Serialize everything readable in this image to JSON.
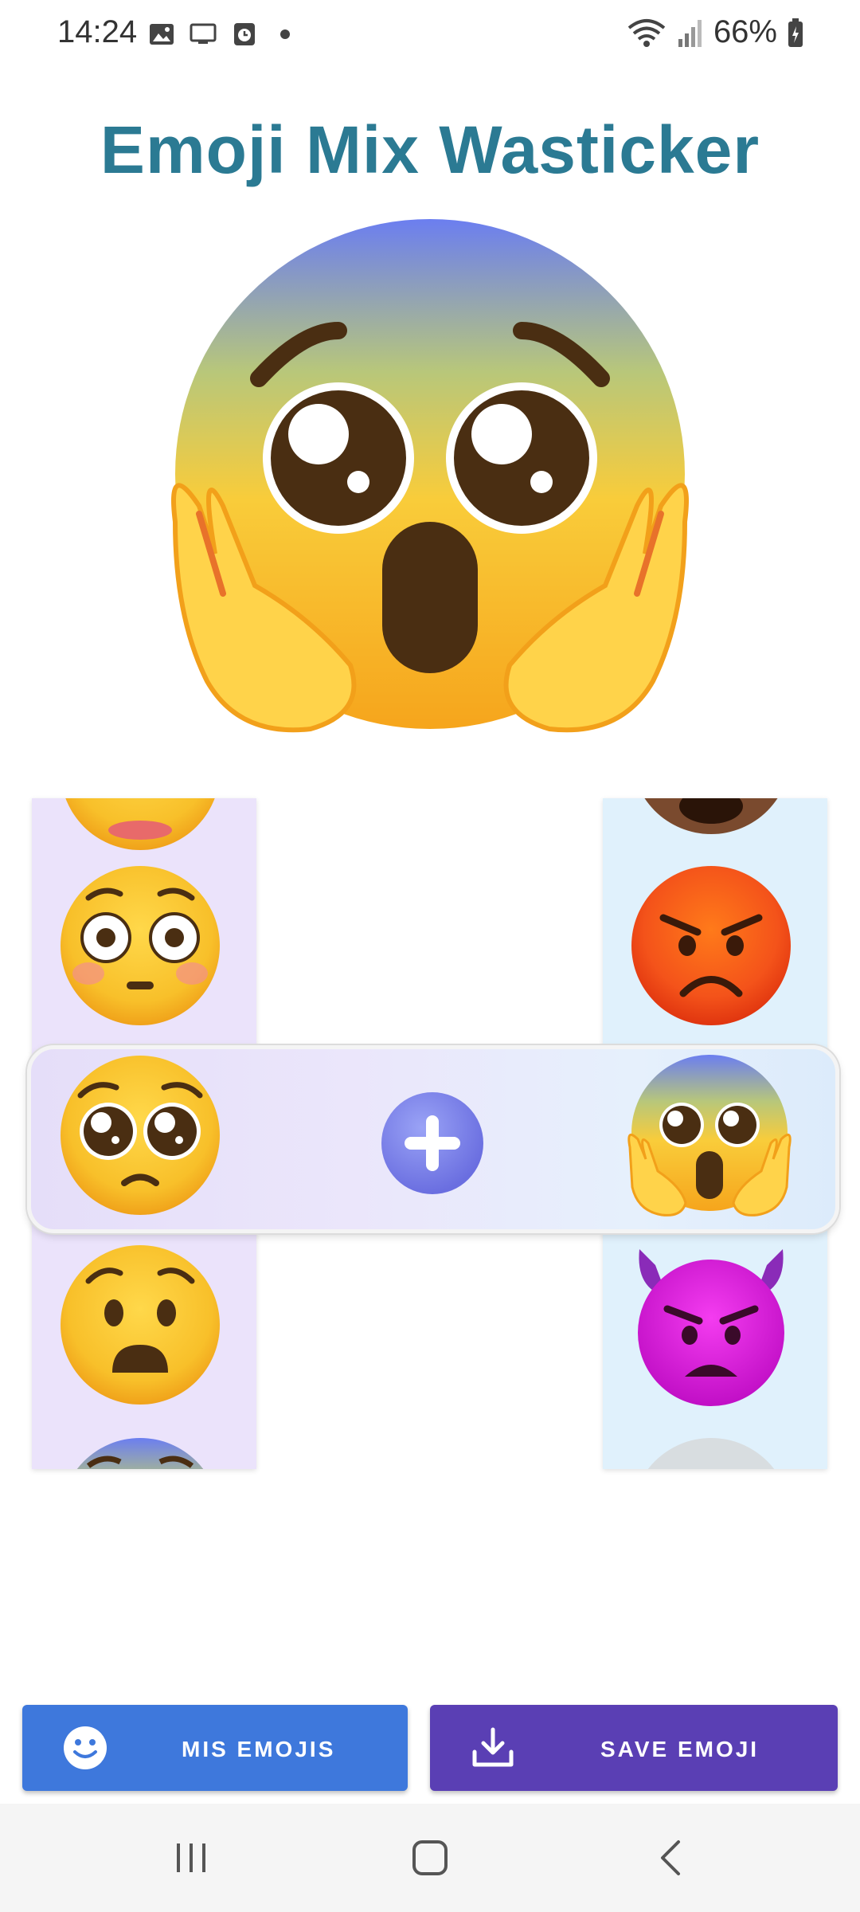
{
  "status_bar": {
    "time": "14:24",
    "battery": "66%",
    "left_icons": [
      "gallery-icon",
      "screen-icon",
      "clock-icon",
      "dot-icon"
    ],
    "right_icons": [
      "wifi-icon",
      "signal-icon",
      "battery-icon"
    ]
  },
  "title": "Emoji Mix Wasticker",
  "result_emoji": "shocked-pleading-emoji",
  "left_column": {
    "background": "#ebe3fb",
    "items": [
      "grinning-emoji-partial",
      "flushed-emoji",
      "pleading-face-emoji",
      "anguished-emoji",
      "blue-face-emoji-partial"
    ],
    "selected": "pleading-face-emoji"
  },
  "right_column": {
    "background": "#e0f1fc",
    "items": [
      "brown-face-emoji-partial",
      "angry-face-emoji",
      "face-screaming-in-fear-emoji",
      "smiling-devil-angry-emoji",
      "gray-face-emoji-partial"
    ],
    "selected": "face-screaming-in-fear-emoji"
  },
  "plus_button": "plus-icon",
  "buttons": {
    "mis_emojis": "MIS EMOJIS",
    "save_emoji": "SAVE EMOJI"
  },
  "colors": {
    "title": "#2b7a93",
    "mis_button": "#3e78dc",
    "save_button": "#5a3fb4"
  },
  "nav_bar": [
    "recents-icon",
    "home-icon",
    "back-icon"
  ]
}
